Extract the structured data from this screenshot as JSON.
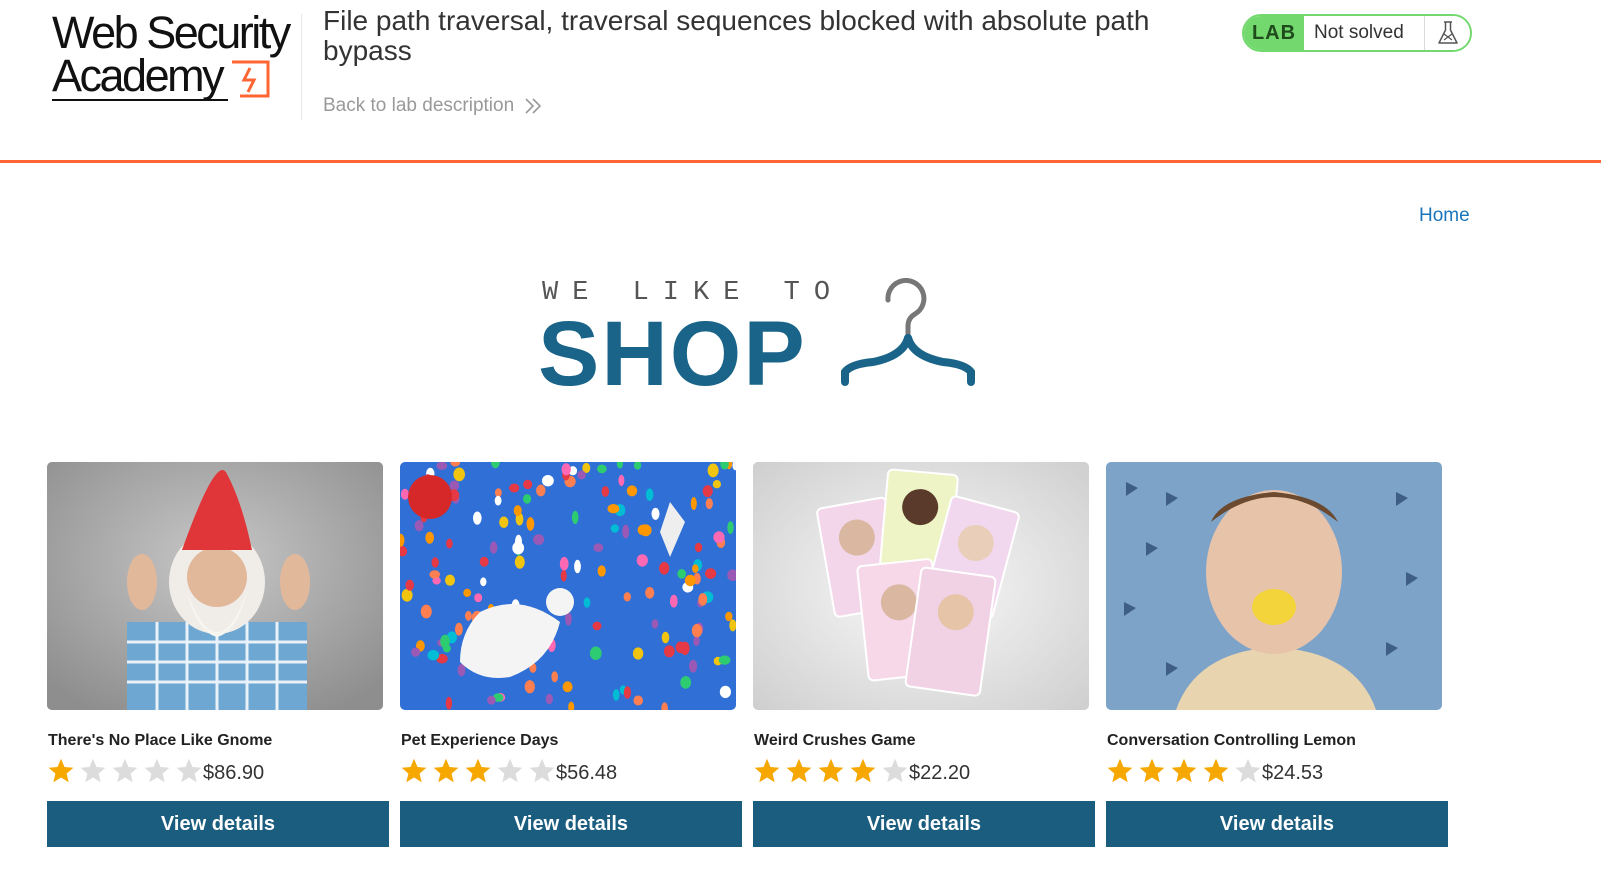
{
  "header": {
    "logo_line1": "Web Security",
    "logo_line2": "Academy",
    "lab_title": "File path traversal, traversal sequences blocked with absolute path bypass",
    "back_link": "Back to lab description",
    "status_badge": "LAB",
    "status_text": "Not solved",
    "accent_color": "#ff6633",
    "badge_color": "#73d96e",
    "icons": {
      "back": "double-chevron-right-icon",
      "flask": "flask-icon"
    }
  },
  "nav": {
    "home": "Home"
  },
  "hero": {
    "tagline": "WE LIKE TO",
    "word": "SHOP",
    "color": "#1a6489",
    "icon": "hanger-icon"
  },
  "products": [
    {
      "name": "There's No Place Like Gnome",
      "rating": 1,
      "price": "$86.90",
      "button": "View details",
      "image_icon": "gnome-image"
    },
    {
      "name": "Pet Experience Days",
      "rating": 3,
      "price": "$56.48",
      "button": "View details",
      "image_icon": "balloons-dog-image"
    },
    {
      "name": "Weird Crushes Game",
      "rating": 4,
      "price": "$22.20",
      "button": "View details",
      "image_icon": "trading-cards-image"
    },
    {
      "name": "Conversation Controlling Lemon",
      "rating": 4,
      "price": "$24.53",
      "button": "View details",
      "image_icon": "lemon-face-image"
    }
  ],
  "rating_max": 5,
  "colors": {
    "star_on": "#f6a800",
    "star_off": "#dcdcdc",
    "button": "#1b5d7e",
    "link": "#1b75bb"
  }
}
